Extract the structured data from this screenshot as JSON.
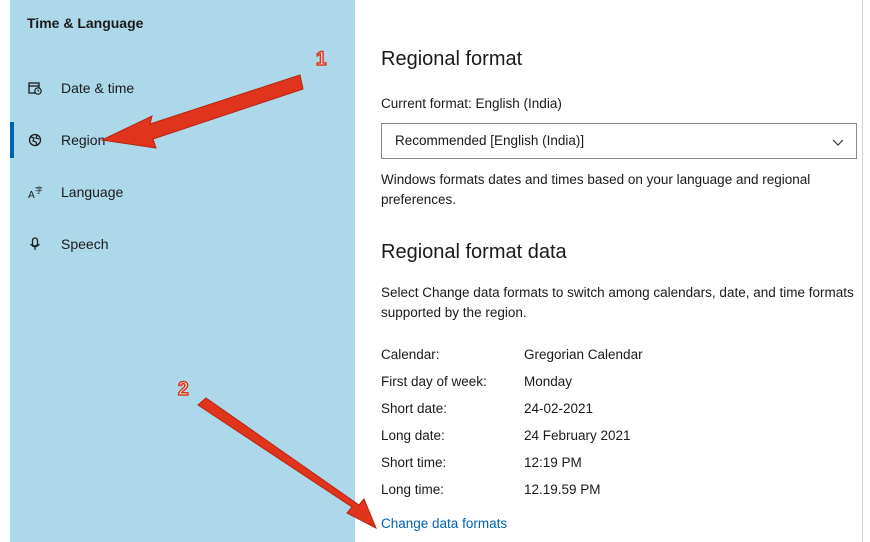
{
  "sidebar": {
    "title": "Time & Language",
    "items": [
      {
        "label": "Date & time",
        "icon": "calendar-clock-icon"
      },
      {
        "label": "Region",
        "icon": "globe-icon",
        "selected": true
      },
      {
        "label": "Language",
        "icon": "language-icon"
      },
      {
        "label": "Speech",
        "icon": "microphone-icon"
      }
    ]
  },
  "main": {
    "regional_format": {
      "heading": "Regional format",
      "current_format": "Current format: English (India)",
      "dropdown_value": "Recommended [English (India)]",
      "description": "Windows formats dates and times based on your language and regional preferences."
    },
    "regional_format_data": {
      "heading": "Regional format data",
      "description": "Select Change data formats to switch among calendars, date, and time formats supported by the region.",
      "rows": [
        {
          "key": "Calendar:",
          "value": "Gregorian Calendar"
        },
        {
          "key": "First day of week:",
          "value": "Monday"
        },
        {
          "key": "Short date:",
          "value": "24-02-2021"
        },
        {
          "key": "Long date:",
          "value": "24 February 2021"
        },
        {
          "key": "Short time:",
          "value": "12:19 PM"
        },
        {
          "key": "Long time:",
          "value": "12.19.59 PM"
        }
      ],
      "link": "Change data formats"
    }
  },
  "annotations": {
    "step1": "1",
    "step2": "2",
    "arrow_color": "#e0341c"
  },
  "colors": {
    "sidebar_bg": "#add8e9",
    "accent": "#0063b1"
  }
}
